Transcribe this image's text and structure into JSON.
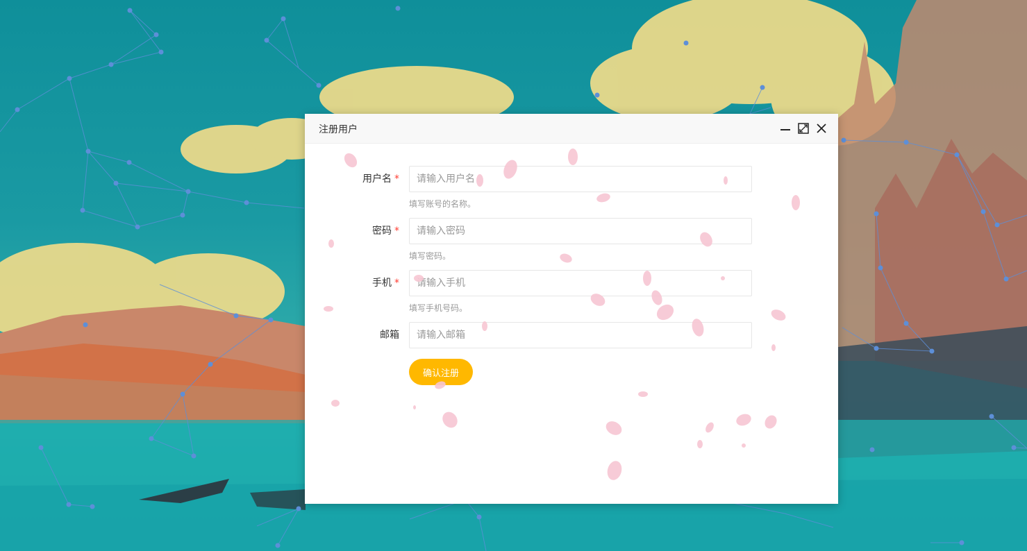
{
  "dialog": {
    "title": "注册用户",
    "window_controls": [
      "minimize-icon",
      "maximize-icon",
      "close-icon"
    ]
  },
  "form": {
    "fields": [
      {
        "label": "用户名",
        "required": true,
        "placeholder": "请输入用户名",
        "hint": "填写账号的名称。"
      },
      {
        "label": "密码",
        "required": true,
        "placeholder": "请输入密码",
        "hint": "填写密码。"
      },
      {
        "label": "手机",
        "required": true,
        "placeholder": "请输入手机",
        "hint": "填写手机号码。"
      },
      {
        "label": "邮箱",
        "required": false,
        "placeholder": "请输入邮箱",
        "hint": ""
      }
    ],
    "required_mark": "*",
    "submit_label": "确认注册"
  },
  "colors": {
    "accent": "#ffb800",
    "required": "#ff3b30",
    "header_bg": "#f8f8f8"
  }
}
